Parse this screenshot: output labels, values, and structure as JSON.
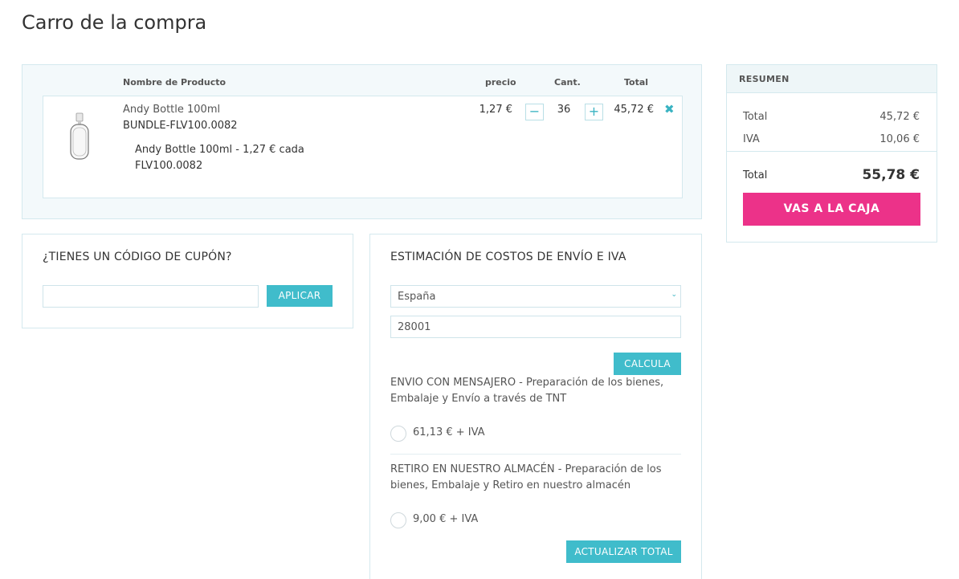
{
  "page": {
    "title": "Carro de la compra"
  },
  "cart": {
    "headers": {
      "product": "Nombre de Producto",
      "price": "precio",
      "qty": "Cant.",
      "total": "Total"
    },
    "item": {
      "name": "Andy Bottle 100ml",
      "sku": "BUNDLE-FLV100.0082",
      "component_line": "Andy Bottle 100ml - 1,27 € cada",
      "component_sku": "FLV100.0082",
      "price": "1,27 €",
      "minus": "−",
      "qty": "36",
      "plus": "+",
      "total": "45,72 €",
      "remove_icon": "✖"
    }
  },
  "coupon": {
    "title": "¿TIENES UN CÓDIGO DE CUPÓN?",
    "input_value": "",
    "apply_label": "APLICAR"
  },
  "shipping": {
    "title": "ESTIMACIÓN DE COSTOS DE ENVÍO E IVA",
    "country": "España",
    "chevron": "⌄",
    "postcode": "28001",
    "calc_label": "CALCULA",
    "methods": [
      {
        "text": "ENVIO CON MENSAJERO - Preparación de los bienes, Embalaje y Envío a través de TNT",
        "price": "61,13 € + IVA"
      },
      {
        "text": "RETIRO EN NUESTRO ALMACÉN - Preparación de los bienes, Embalaje y Retiro en nuestro almacén",
        "price": "9,00 € + IVA"
      }
    ],
    "update_label": "ACTUALIZAR TOTAL"
  },
  "summary": {
    "title": "RESUMEN",
    "subtotal_label": "Total",
    "subtotal_value": "45,72 €",
    "tax_label": "IVA",
    "tax_value": "10,06 €",
    "grand_label": "Total",
    "grand_value": "55,78 €",
    "checkout_label": "VAS A LA CAJA"
  },
  "colors": {
    "accent": "#40bccb",
    "checkout": "#ec3289",
    "border": "#d4e9ee"
  }
}
